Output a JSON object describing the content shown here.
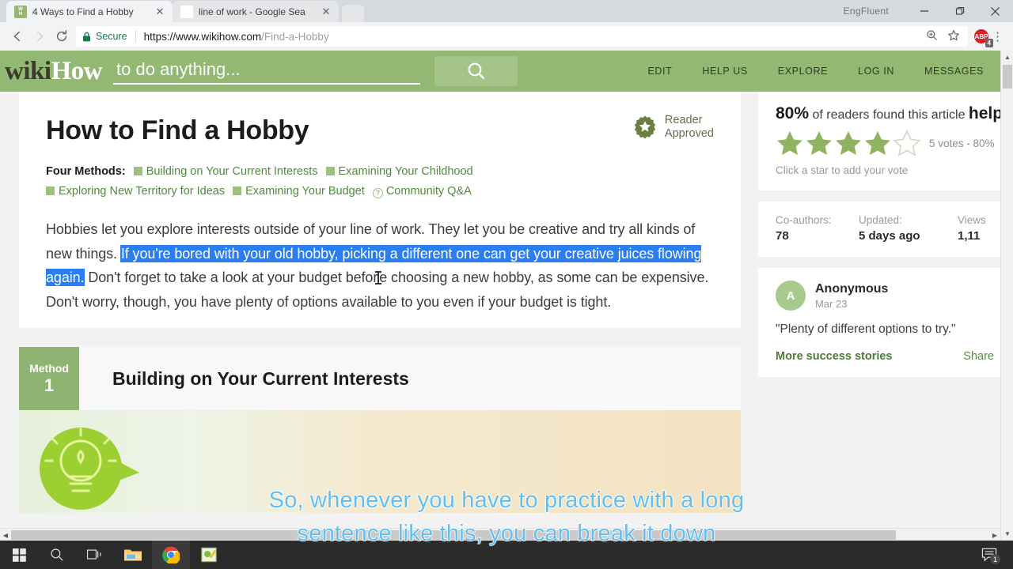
{
  "browser": {
    "tabs": [
      {
        "title": "4 Ways to Find a Hobby",
        "favicon": "wikihow-icon",
        "active": true,
        "close": "✕"
      },
      {
        "title": "line of work - Google Sea",
        "favicon": "google-icon",
        "active": false,
        "close": "✕"
      }
    ],
    "window_label": "EngFluent",
    "window_controls": {
      "minimize": "–",
      "maximize": "❐",
      "close": "✕"
    },
    "nav": {
      "back": "←",
      "forward": "→",
      "reload": "⟳"
    },
    "omnibox": {
      "secure_label": "Secure",
      "url_domain": "https://www.wikihow.com",
      "url_path": "/Find-a-Hobby",
      "zoom_icon": "zoom-in-icon",
      "bookmark_icon": "star-icon",
      "extension": {
        "name": "ABP",
        "badge": "4"
      },
      "menu_icon": "⋮"
    }
  },
  "site": {
    "logo": {
      "part1": "wiki",
      "part2": "How"
    },
    "search_placeholder": "to do anything...",
    "search_value": "",
    "search_button_icon": "search-icon",
    "nav_items": [
      "EDIT",
      "HELP US",
      "EXPLORE",
      "LOG IN",
      "MESSAGES"
    ]
  },
  "article": {
    "title": "How to Find a Hobby",
    "reader_approved": {
      "line1": "Reader",
      "line2": "Approved"
    },
    "methods_label": "Four Methods:",
    "methods": [
      {
        "label": "Building on Your Current Interests",
        "marker": "square"
      },
      {
        "label": "Examining Your Childhood",
        "marker": "square"
      },
      {
        "label": "Exploring New Territory for Ideas",
        "marker": "square"
      },
      {
        "label": "Examining Your Budget",
        "marker": "square"
      },
      {
        "label": "Community Q&A",
        "marker": "question"
      }
    ],
    "intro": {
      "before": "Hobbies let you explore interests outside of your line of work. They let you be creative and try all kinds of new things. ",
      "selected": "If you're bored with your old hobby, picking a different one can get your creative juices flowing again.",
      "after_part1": " Don't forget to take a look at your budget befor",
      "after_part2": "e choosing a new hobby, as some can be expensive. Don't worry, though, you have plenty of options available to you even if your budget is tight."
    },
    "method_block": {
      "badge_word": "Method",
      "badge_number": "1",
      "heading": "Building on Your Current Interests",
      "image_icon": "lightbulb-idea-bubble-icon"
    }
  },
  "sidebar": {
    "rating": {
      "percent": "80%",
      "text": " of readers found this article ",
      "text_bold": "help",
      "stars_filled": 4,
      "stars_total": 5,
      "votes": "5 votes - 80%",
      "hint": "Click a star to add your vote"
    },
    "stats": [
      {
        "label": "Co-authors:",
        "value": "78"
      },
      {
        "label": "Updated:",
        "value": "5 days ago"
      },
      {
        "label": "Views",
        "value": "1,11"
      }
    ],
    "testimonial": {
      "avatar_letter": "A",
      "name": "Anonymous",
      "date": "Mar 23",
      "quote": "\"Plenty of different options to try.\"",
      "more_link": "More success stories",
      "share_link": "Share"
    }
  },
  "subtitles": {
    "line1": "So, whenever you have to practice with a long",
    "line2": "sentence like this, you can break it down",
    "color": "#62bdf0"
  },
  "taskbar": {
    "items": [
      {
        "name": "start-button",
        "icon": "windows-icon"
      },
      {
        "name": "search-button",
        "icon": "search-icon"
      },
      {
        "name": "task-view-button",
        "icon": "task-view-icon"
      },
      {
        "name": "file-explorer",
        "icon": "folder-icon"
      },
      {
        "name": "chrome",
        "icon": "chrome-icon"
      },
      {
        "name": "notepad-app",
        "icon": "app-icon"
      }
    ],
    "notification": {
      "icon": "chat-icon",
      "badge": "1"
    }
  },
  "colors": {
    "wikihow_green": "#93b874",
    "selection_blue": "#2a7ef1",
    "star_green": "#8fb35e",
    "subtitle_blue": "#62bdf0"
  }
}
